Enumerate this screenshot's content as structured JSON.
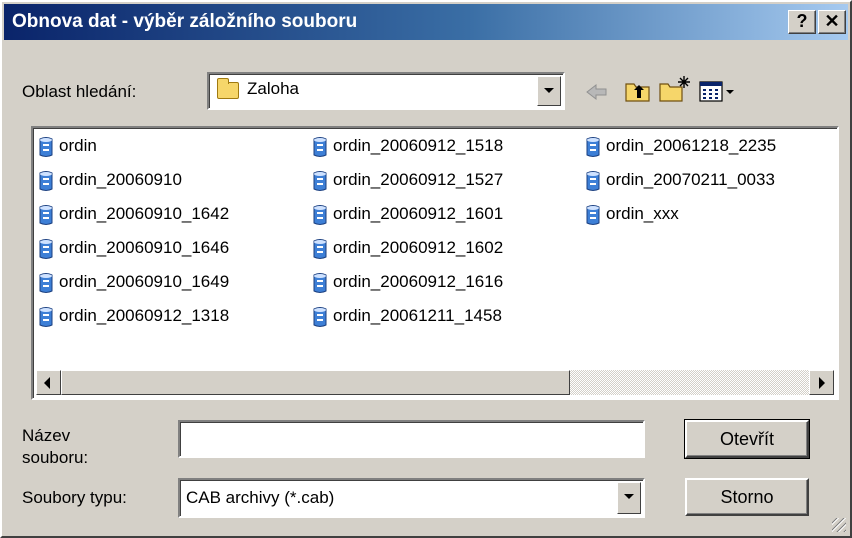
{
  "window": {
    "title": "Obnova dat - výběr záložního souboru",
    "help_label": "?",
    "close_label": "✕"
  },
  "lookin": {
    "label": "Oblast hledání:",
    "value": "Zaloha"
  },
  "toolbar": {
    "icons": [
      "back-arrow-icon",
      "up-one-level-icon",
      "new-folder-icon",
      "view-menu-icon"
    ]
  },
  "files": [
    "ordin",
    "ordin_20060910",
    "ordin_20060910_1642",
    "ordin_20060910_1646",
    "ordin_20060910_1649",
    "ordin_20060912_1318",
    "ordin_20060912_1518",
    "ordin_20060912_1527",
    "ordin_20060912_1601",
    "ordin_20060912_1602",
    "ordin_20060912_1616",
    "ordin_20061211_1458",
    "ordin_20061218_2235",
    "ordin_20070211_0033",
    "ordin_xxx"
  ],
  "filename": {
    "label_line1": "Název",
    "label_line2": "souboru:",
    "value": ""
  },
  "filetype": {
    "label": "Soubory typu:",
    "value": "CAB archivy (*.cab)"
  },
  "buttons": {
    "open": "Otevřít",
    "cancel": "Storno"
  }
}
